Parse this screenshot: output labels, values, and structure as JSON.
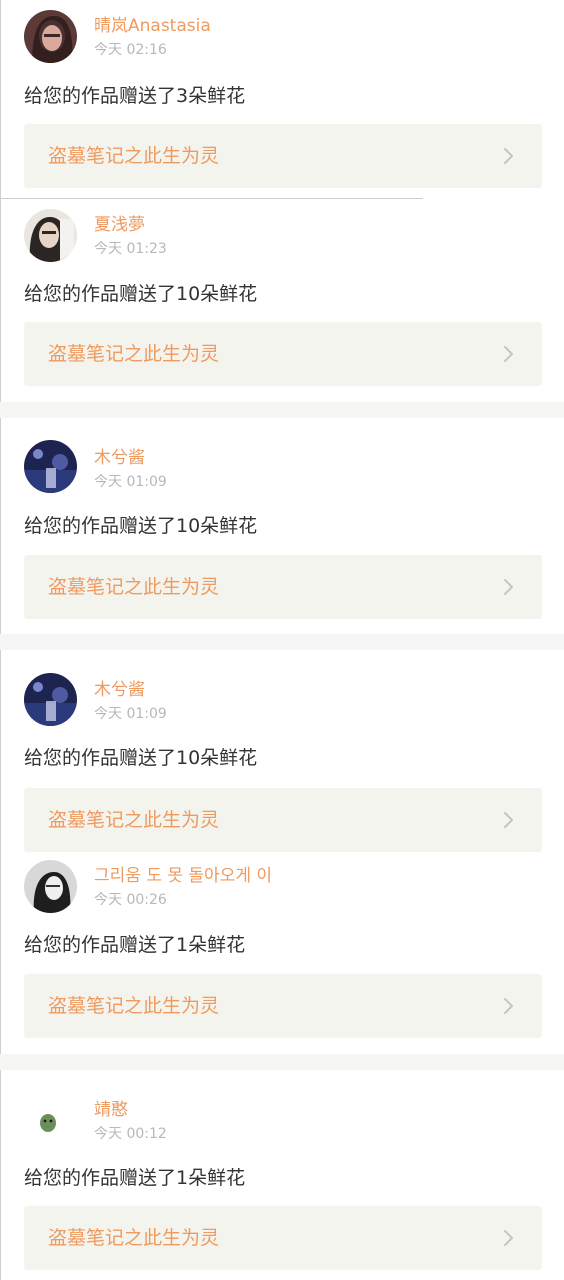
{
  "theme": {
    "accent": "#ef9a5f",
    "timestamp_color": "#b8b8b8",
    "message_color": "#333333",
    "card_bg": "#f4f4ee",
    "chevron_color": "#c4c4c4",
    "separator_color": "#f6f6f4"
  },
  "gift_list": [
    {
      "username": "晴岚Anastasia",
      "time": "今天 02:16",
      "message": "给您的作品赠送了3朵鲜花",
      "work_title": "盗墓笔记之此生为灵",
      "avatar": "portrait-dark-hair"
    },
    {
      "username": "夏浅夢",
      "time": "今天 01:23",
      "message": "给您的作品赠送了10朵鲜花",
      "work_title": "盗墓笔记之此生为灵",
      "avatar": "portrait-long-hair"
    },
    {
      "username": "木兮酱",
      "time": "今天 01:09",
      "message": "给您的作品赠送了10朵鲜花",
      "work_title": "盗墓笔记之此生为灵",
      "avatar": "night-scene-blue"
    },
    {
      "username": "木兮酱",
      "time": "今天 01:09",
      "message": "给您的作品赠送了10朵鲜花",
      "work_title": "盗墓笔记之此生为灵",
      "avatar": "night-scene-blue"
    },
    {
      "username": "그리움 도 못 돌아오게 이",
      "time": "今天 00:26",
      "message": "给您的作品赠送了1朵鲜花",
      "work_title": "盗墓笔记之此生为灵",
      "avatar": "portrait-black-white"
    },
    {
      "username": "靖憨",
      "time": "今天 00:12",
      "message": "给您的作品赠送了1朵鲜花",
      "work_title": "盗墓笔记之此生为灵",
      "avatar": "green-creature-icon"
    }
  ]
}
